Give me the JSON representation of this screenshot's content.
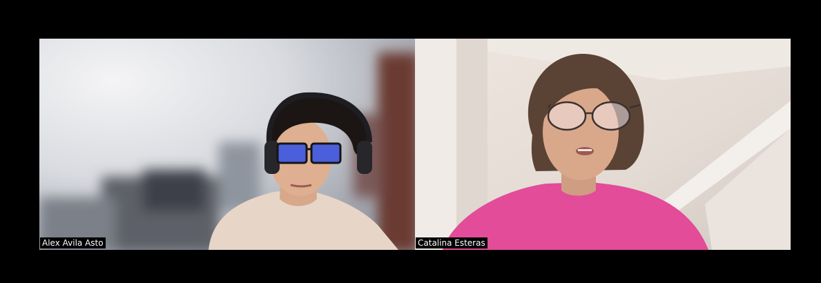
{
  "participants": [
    {
      "name": "Alex Avila Asto"
    },
    {
      "name": "Catalina Esteras"
    }
  ],
  "colors": {
    "background": "#000000",
    "label_background": "#000000",
    "label_text": "#ffffff"
  }
}
